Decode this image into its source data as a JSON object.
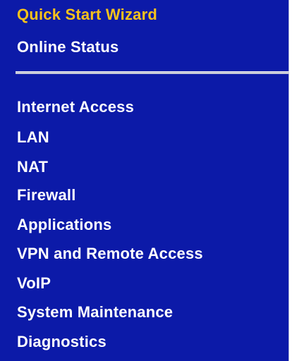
{
  "colors": {
    "sidebar_background": "#0c1aa8",
    "link_text": "#ffffff",
    "active_link_text": "#f7c21b",
    "divider": "#c8cad8"
  },
  "menu": {
    "top_items": [
      {
        "label": "Quick Start Wizard",
        "active": true
      },
      {
        "label": "Online Status",
        "active": false
      }
    ],
    "main_items": [
      {
        "label": "Internet Access"
      },
      {
        "label": "LAN"
      },
      {
        "label": "NAT"
      },
      {
        "label": "Firewall"
      },
      {
        "label": "Applications"
      },
      {
        "label": "VPN and Remote Access"
      },
      {
        "label": "VoIP"
      },
      {
        "label": "System Maintenance"
      },
      {
        "label": "Diagnostics"
      }
    ]
  }
}
